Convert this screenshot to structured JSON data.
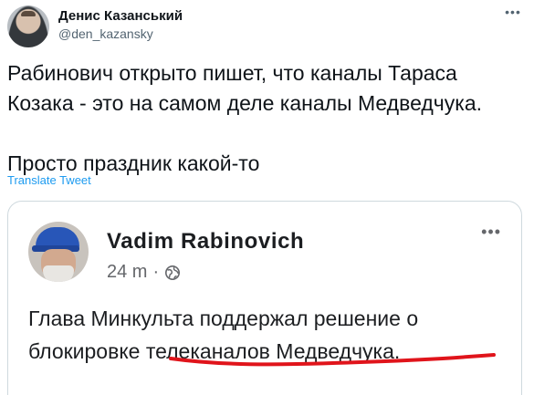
{
  "tweet": {
    "author": {
      "display_name": "Денис Казанський",
      "handle": "@den_kazansky"
    },
    "more_icon": "more-horizontal-icon",
    "text": "Рабинович открыто пишет, что каналы Тараса Козака - это на самом деле каналы Медведчука.\n\nПросто праздник какой-то",
    "translate_label": "Translate Tweet"
  },
  "quoted_post": {
    "author_name": "Vadim Rabinovich",
    "time": "24 m",
    "separator": "·",
    "privacy_icon": "globe-icon",
    "more_icon": "more-horizontal-icon",
    "text": "Глава Минкульта поддержал решение о блокировке телеканалов Медведчука.",
    "underline_color": "#e0141b"
  },
  "colors": {
    "link": "#1d9bf0",
    "secondary_text": "#536471",
    "card_border": "#cfd9de"
  }
}
